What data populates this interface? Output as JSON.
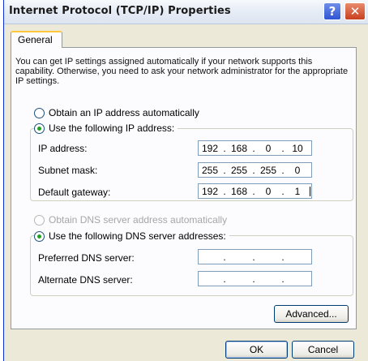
{
  "window": {
    "title": "Internet Protocol (TCP/IP) Properties",
    "help_symbol": "?",
    "close_symbol": "✕"
  },
  "tabs": [
    {
      "label": "General",
      "selected": true
    }
  ],
  "description": "You can get IP settings assigned automatically if your network supports this capability. Otherwise, you need to ask your network administrator for the appropriate IP settings.",
  "ip_section": {
    "auto_label": "Obtain an IP address automatically",
    "auto_selected": false,
    "manual_label": "Use the following IP address:",
    "manual_selected": true,
    "fields": [
      {
        "label": "IP address:",
        "octets": [
          "192",
          "168",
          "0",
          "10"
        ]
      },
      {
        "label": "Subnet mask:",
        "octets": [
          "255",
          "255",
          "255",
          "0"
        ]
      },
      {
        "label": "Default gateway:",
        "octets": [
          "192",
          "168",
          "0",
          "1"
        ]
      }
    ]
  },
  "dns_section": {
    "auto_label": "Obtain DNS server address automatically",
    "auto_enabled": false,
    "manual_label": "Use the following DNS server addresses:",
    "manual_selected": true,
    "fields": [
      {
        "label": "Preferred DNS server:",
        "octets": [
          "",
          "",
          "",
          ""
        ]
      },
      {
        "label": "Alternate DNS server:",
        "octets": [
          "",
          "",
          "",
          ""
        ]
      }
    ]
  },
  "buttons": {
    "advanced": "Advanced...",
    "ok": "OK",
    "cancel": "Cancel"
  },
  "dot": "."
}
